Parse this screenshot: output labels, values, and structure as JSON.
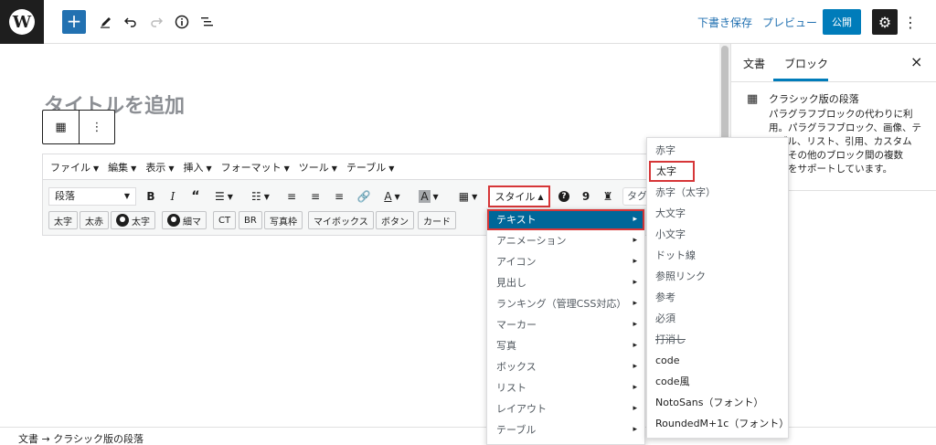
{
  "topbar": {
    "logo": "W",
    "add_icon": "+",
    "draft_save": "下書き保存",
    "preview": "プレビュー",
    "publish": "公開",
    "icons": [
      "plus-icon",
      "pen-icon",
      "undo-icon",
      "redo-icon",
      "info-icon",
      "list-view-icon",
      "gear-icon",
      "more-vertical-icon"
    ]
  },
  "editor": {
    "title_placeholder": "タイトルを追加",
    "block_toolbar": {
      "block_icon": "▦",
      "more": "⋮"
    },
    "menubar": [
      {
        "label": "ファイル"
      },
      {
        "label": "編集"
      },
      {
        "label": "表示"
      },
      {
        "label": "挿入"
      },
      {
        "label": "フォーマット"
      },
      {
        "label": "ツール"
      },
      {
        "label": "テーブル"
      }
    ],
    "toolbar_row1": {
      "format_select": "段落",
      "style_button": "スタイル",
      "tag_input": "タグ"
    },
    "toolbar_row2": [
      "太字",
      "太赤",
      "太字",
      "細マ",
      "CT",
      "BR",
      "写真枠",
      "マイボックス",
      "ボタン",
      "カード"
    ]
  },
  "style_menu": {
    "items": [
      {
        "label": "テキスト",
        "active": true
      },
      {
        "label": "アニメーション"
      },
      {
        "label": "アイコン"
      },
      {
        "label": "見出し"
      },
      {
        "label": "ランキング（管理CSS対応）"
      },
      {
        "label": "マーカー"
      },
      {
        "label": "写真"
      },
      {
        "label": "ボックス"
      },
      {
        "label": "リスト"
      },
      {
        "label": "レイアウト"
      },
      {
        "label": "テーブル"
      }
    ]
  },
  "sub_menu": {
    "items": [
      {
        "label": "赤字"
      },
      {
        "label": "太字",
        "highlighted": true
      },
      {
        "label": "赤字（太字）"
      },
      {
        "label": "大文字"
      },
      {
        "label": "小文字"
      },
      {
        "label": "ドット線"
      },
      {
        "label": "参照リンク"
      },
      {
        "label": "参考"
      },
      {
        "label": "必須"
      },
      {
        "label": "打消し",
        "strike": true
      },
      {
        "label": "code"
      },
      {
        "label": "code風"
      },
      {
        "label": "NotoSans（フォント）"
      },
      {
        "label": "RoundedM+1c（フォント）"
      }
    ]
  },
  "sidebar": {
    "tab_document": "文書",
    "tab_block": "ブロック",
    "close": "×",
    "block_title": "クラシック版の段落",
    "block_description": "パラグラフブロックの代わりに利用。パラグラフブロック、画像、テーブル、リスト、引用、カスタム　　ル、その他のブロック間の複数　　機能をサポートしています。"
  },
  "footer": {
    "breadcrumb": "文書 → クラシック版の段落"
  }
}
